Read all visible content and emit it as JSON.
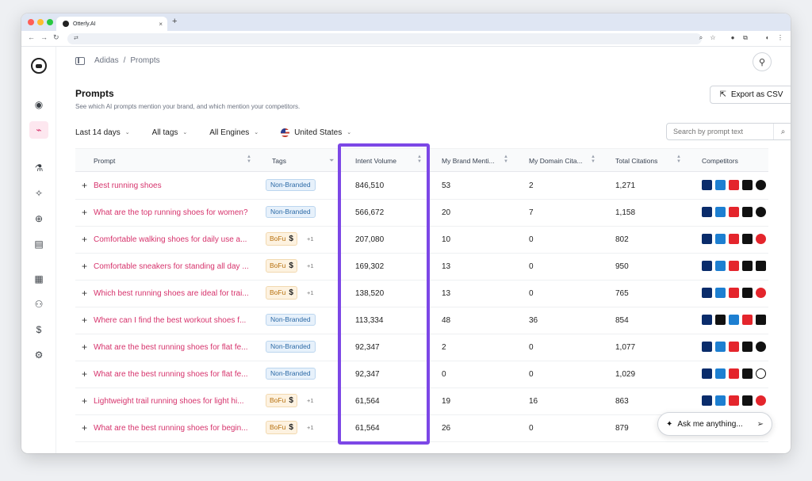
{
  "browser": {
    "tab_title": "Otterly.AI",
    "new_tab": "+",
    "tab_close": "×"
  },
  "breadcrumb": {
    "brand": "Adidas",
    "separator": "/",
    "page": "Prompts"
  },
  "page": {
    "title": "Prompts",
    "subtitle": "See which AI prompts mention your brand, and which mention your competitors.",
    "export_label": "Export as CSV"
  },
  "filters": {
    "date": "Last 14 days",
    "tags": "All tags",
    "engines": "All Engines",
    "country": "United States"
  },
  "search": {
    "placeholder": "Search by prompt text"
  },
  "table": {
    "columns": {
      "prompt": "Prompt",
      "tags": "Tags",
      "intent_volume": "Intent Volume",
      "brand_mentions": "My Brand Menti...",
      "domain_citations": "My Domain Cita...",
      "total_citations": "Total Citations",
      "competitors": "Competitors"
    },
    "rows": [
      {
        "prompt": "Best running shoes",
        "tag": "Non-Branded",
        "tag_type": "nb",
        "more": "",
        "volume": "846,510",
        "brand": "53",
        "domain": "2",
        "total": "1,271",
        "comps": [
          "asics",
          "hoka",
          "nb",
          "nike",
          "puma"
        ]
      },
      {
        "prompt": "What are the top running shoes for women?",
        "tag": "Non-Branded",
        "tag_type": "nb",
        "more": "",
        "volume": "566,672",
        "brand": "20",
        "domain": "7",
        "total": "1,158",
        "comps": [
          "asics",
          "hoka",
          "nb",
          "nike",
          "puma"
        ]
      },
      {
        "prompt": "Comfortable walking shoes for daily use a...",
        "tag": "BoFu",
        "tag_type": "bofu",
        "more": "+1",
        "volume": "207,080",
        "brand": "10",
        "domain": "0",
        "total": "802",
        "comps": [
          "asics",
          "hoka",
          "nb",
          "nike",
          "ua"
        ]
      },
      {
        "prompt": "Comfortable sneakers for standing all day ...",
        "tag": "BoFu",
        "tag_type": "bofu",
        "more": "+1",
        "volume": "169,302",
        "brand": "13",
        "domain": "0",
        "total": "950",
        "comps": [
          "asics",
          "hoka",
          "nb",
          "nike",
          "sal"
        ]
      },
      {
        "prompt": "Which best running shoes are ideal for trai...",
        "tag": "BoFu",
        "tag_type": "bofu",
        "more": "+1",
        "volume": "138,520",
        "brand": "13",
        "domain": "0",
        "total": "765",
        "comps": [
          "asics",
          "hoka",
          "nb",
          "nike",
          "ua"
        ]
      },
      {
        "prompt": "Where can I find the best workout shoes f...",
        "tag": "Non-Branded",
        "tag_type": "nb",
        "more": "",
        "volume": "113,334",
        "brand": "48",
        "domain": "36",
        "total": "854",
        "comps": [
          "asics",
          "sal",
          "hoka",
          "nb",
          "nike"
        ]
      },
      {
        "prompt": "What are the best running shoes for flat fe...",
        "tag": "Non-Branded",
        "tag_type": "nb",
        "more": "",
        "volume": "92,347",
        "brand": "2",
        "domain": "0",
        "total": "1,077",
        "comps": [
          "asics",
          "hoka",
          "nb",
          "nike",
          "puma"
        ]
      },
      {
        "prompt": "What are the best running shoes for flat fe...",
        "tag": "Non-Branded",
        "tag_type": "nb",
        "more": "",
        "volume": "92,347",
        "brand": "0",
        "domain": "0",
        "total": "1,029",
        "comps": [
          "asics",
          "hoka",
          "nb",
          "nike",
          "on"
        ]
      },
      {
        "prompt": "Lightweight trail running shoes for light hi...",
        "tag": "BoFu",
        "tag_type": "bofu",
        "more": "+1",
        "volume": "61,564",
        "brand": "19",
        "domain": "16",
        "total": "863",
        "comps": [
          "asics",
          "hoka",
          "nb",
          "nike",
          "ua"
        ]
      },
      {
        "prompt": "What are the best running shoes for begin...",
        "tag": "BoFu",
        "tag_type": "bofu",
        "more": "+1",
        "volume": "61,564",
        "brand": "26",
        "domain": "0",
        "total": "879",
        "comps": []
      }
    ]
  },
  "assistant": {
    "label": "Ask me anything..."
  },
  "colors": {
    "accent_pink": "#d6336c",
    "highlight_purple": "#7c47e6"
  }
}
